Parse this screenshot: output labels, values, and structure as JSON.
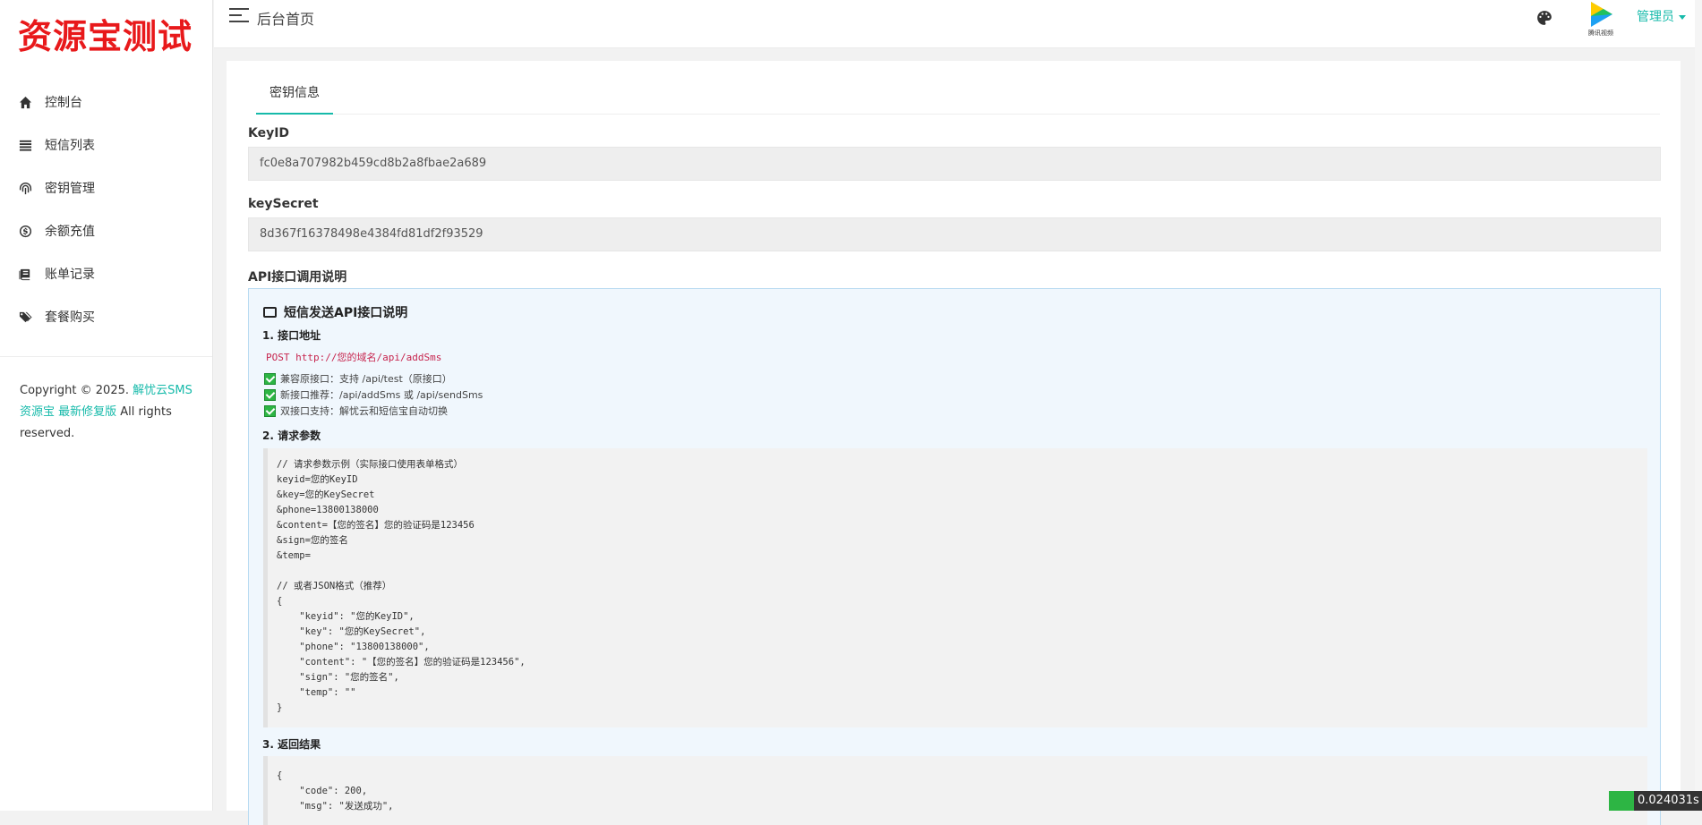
{
  "sidebar": {
    "logo": "资源宝测试",
    "items": [
      {
        "label": "控制台",
        "icon": "home-icon"
      },
      {
        "label": "短信列表",
        "icon": "list-icon"
      },
      {
        "label": "密钥管理",
        "icon": "fingerprint-icon"
      },
      {
        "label": "余额充值",
        "icon": "dollar-icon"
      },
      {
        "label": "账单记录",
        "icon": "book-icon"
      },
      {
        "label": "套餐购买",
        "icon": "tags-icon"
      }
    ],
    "copyright": {
      "prefix": "Copyright © 2025.",
      "link1": "解忧云SMS",
      "link2": "资源宝 最新修复版",
      "suffix": "All rights reserved."
    }
  },
  "header": {
    "title": "后台首页",
    "admin_label": "管理员",
    "avatar_caption": "腾讯视频"
  },
  "main": {
    "tab_label": "密钥信息",
    "keyid_label": "KeyID",
    "keyid_value": "fc0e8a707982b459cd8b2a8fbae2a689",
    "keysecret_label": "keySecret",
    "keysecret_value": "8d367f16378498e4384fd81df2f93529",
    "api_section_label": "API接口调用说明"
  },
  "api": {
    "title": "短信发送API接口说明",
    "s1_title": "1. 接口地址",
    "endpoint": "POST http://您的域名/api/addSms",
    "checks": [
      "兼容原接口：支持 /api/test（原接口）",
      "新接口推荐：/api/addSms 或 /api/sendSms",
      "双接口支持：解忧云和短信宝自动切换"
    ],
    "s2_title": "2. 请求参数",
    "params_code": "// 请求参数示例（实际接口使用表单格式）\nkeyid=您的KeyID\n&key=您的KeySecret\n&phone=13800138000\n&content=【您的签名】您的验证码是123456\n&sign=您的签名\n&temp=\n\n// 或者JSON格式（推荐）\n{\n    \"keyid\": \"您的KeyID\",\n    \"key\": \"您的KeySecret\",\n    \"phone\": \"13800138000\",\n    \"content\": \"【您的签名】您的验证码是123456\",\n    \"sign\": \"您的签名\",\n    \"temp\": \"\"\n}",
    "s3_title": "3. 返回结果",
    "result_code": "{\n    \"code\": 200,\n    \"msg\": \"发送成功\","
  },
  "perf": {
    "time": "0.024031s"
  },
  "colors": {
    "accent": "#16baaa",
    "logo": "#e8191b"
  }
}
